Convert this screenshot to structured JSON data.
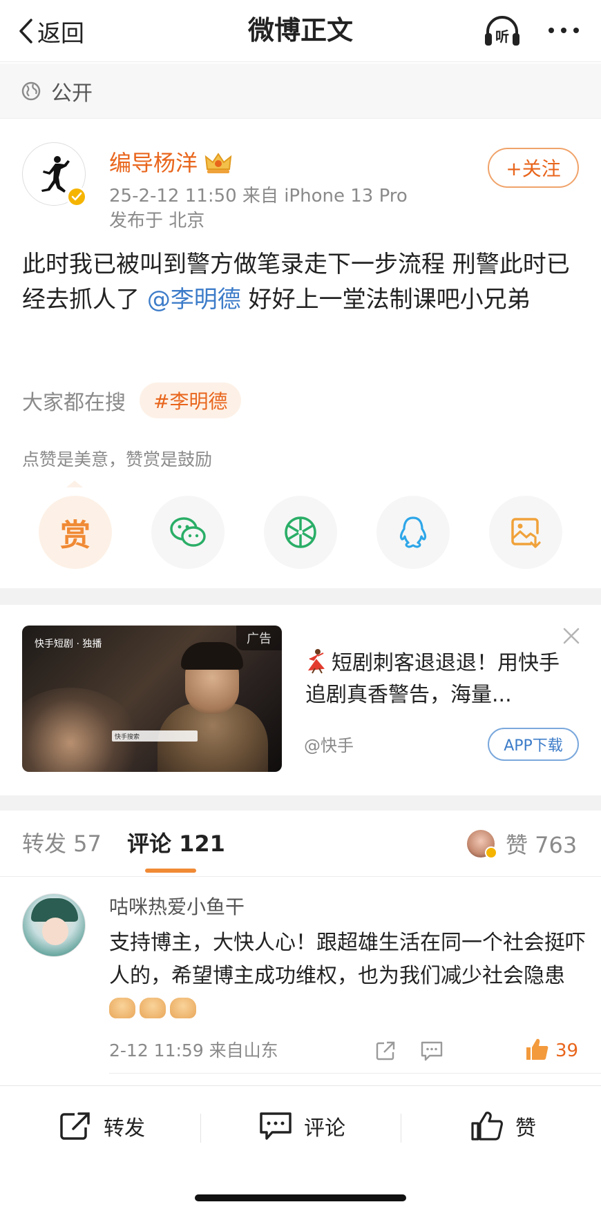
{
  "nav": {
    "back_label": "返回",
    "title": "微博正文",
    "listen_label": "听"
  },
  "visibility": {
    "label": "公开"
  },
  "post": {
    "author": "编导杨洋",
    "meta": "25-2-12 11:50  来自 iPhone 13 Pro",
    "location": "发布于 北京",
    "follow_label": "+关注",
    "text_part1": "此时我已被叫到警方做笔录走下一步流程 刑警此时已经去抓人了 ",
    "mention": "@李明德",
    "text_part2": " 好好上一堂法制课吧小兄弟",
    "search_label": "大家都在搜",
    "search_tag": "#李明德",
    "reward_tip": "点赞是美意，赞赏是鼓励",
    "reward_label": "赏"
  },
  "ad": {
    "title": "短剧刺客退退退！用快手追剧真香警告，海量...",
    "source": "@快手",
    "button": "APP下载",
    "tag": "广告",
    "image_brand": "快手短剧 · 独播",
    "image_search": "快手搜索"
  },
  "tabs": {
    "repost": "转发 57",
    "comments": "评论 121",
    "likes": "赞 763"
  },
  "comment": {
    "name": "咕咪热爱小鱼干",
    "text": "支持博主，大快人心！跟超雄生活在同一个社会挺吓人的，希望博主成功维权，也为我们减少社会隐患",
    "time": "2-12 11:59  来自山东",
    "like_count": "39"
  },
  "bottom": {
    "repost": "转发",
    "comment": "评论",
    "like": "赞"
  },
  "colors": {
    "accent": "#e8651c",
    "link": "#3d7cc9",
    "wechat": "#2aae67",
    "qq": "#2ea6e8"
  }
}
